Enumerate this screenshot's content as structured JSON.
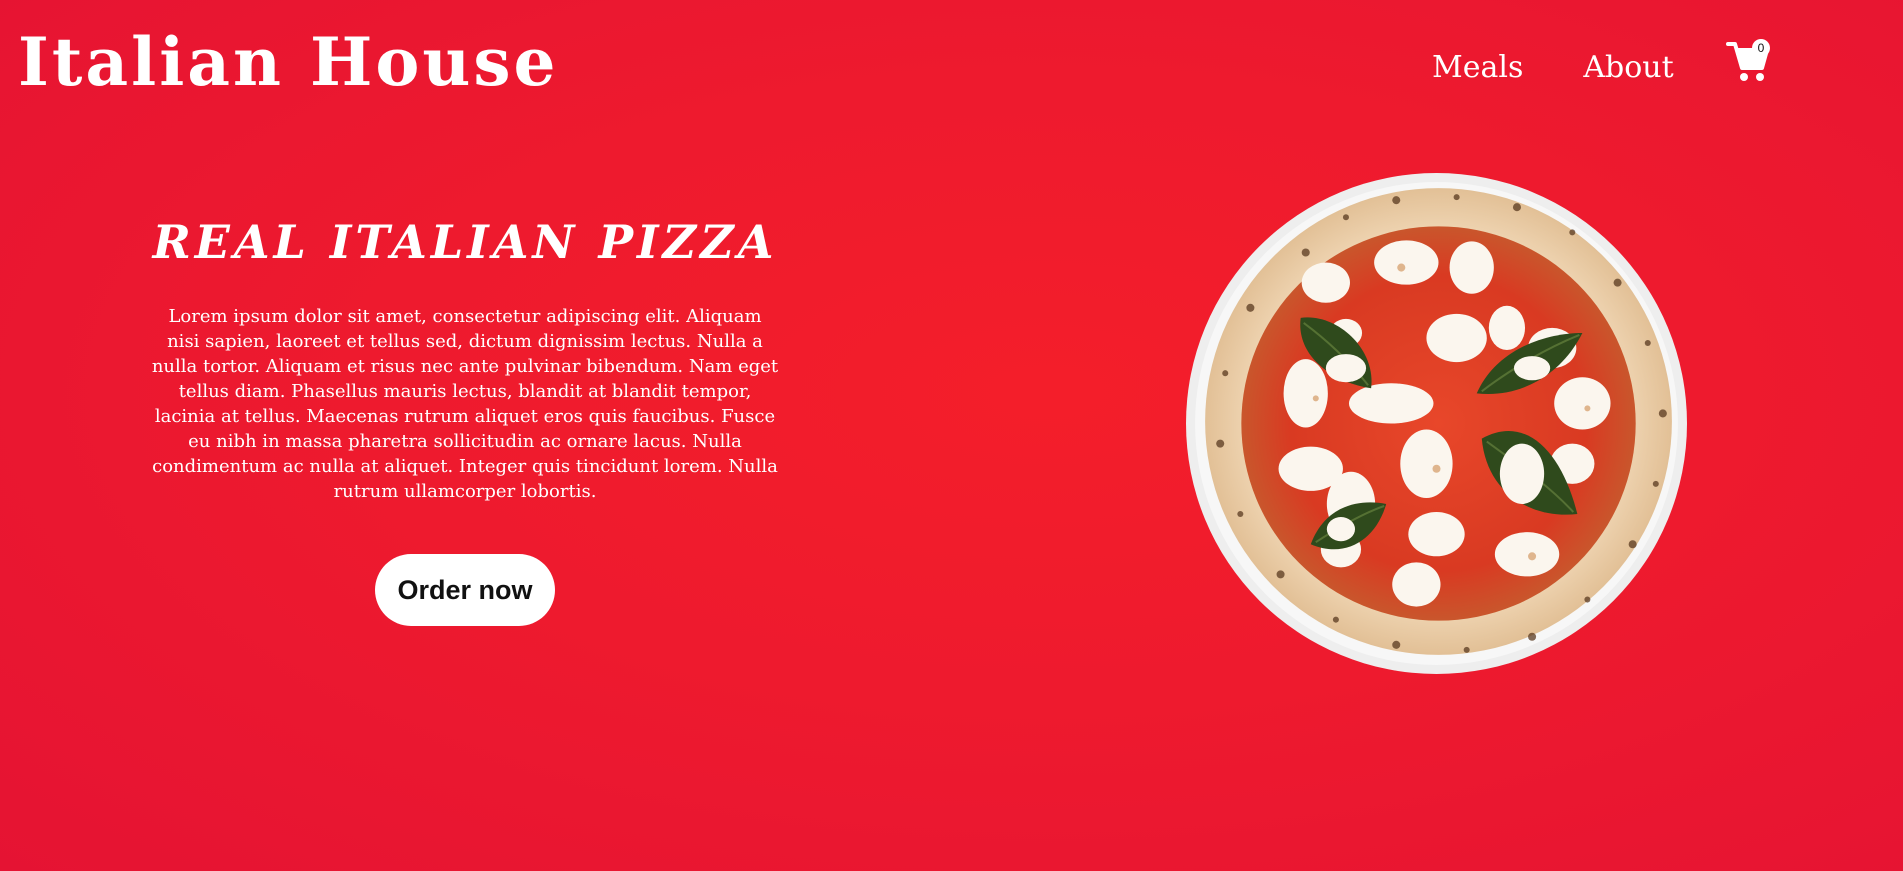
{
  "header": {
    "brand": "Italian House",
    "nav": [
      {
        "label": "Meals"
      },
      {
        "label": "About"
      }
    ],
    "cart": {
      "icon": "cart-icon",
      "count": "0"
    }
  },
  "hero": {
    "title": "REAL ITALIAN PIZZA",
    "description": "Lorem ipsum dolor sit amet, consectetur adipiscing elit. Aliquam nisi sapien, laoreet et tellus sed, dictum dignissim lectus. Nulla a nulla tortor. Aliquam et risus nec ante pulvinar bibendum. Nam eget tellus diam. Phasellus mauris lectus, blandit at blandit tempor, lacinia at tellus. Maecenas rutrum aliquet eros quis faucibus. Fusce eu nibh in massa pharetra sollicitudin ac ornare lacus. Nulla condimentum ac nulla at aliquet. Integer quis tincidunt lorem. Nulla rutrum ullamcorper lobortis.",
    "cta_label": "Order now",
    "image": "margherita-pizza-image"
  },
  "colors": {
    "background": "#ee1a2e",
    "text": "#ffffff",
    "button_bg": "#ffffff",
    "button_text": "#111111"
  }
}
